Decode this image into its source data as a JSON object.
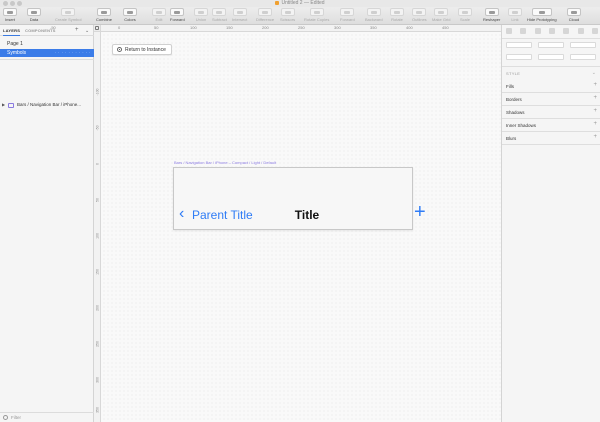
{
  "window": {
    "title": "Untitled 2 — Edited"
  },
  "toolbar": {
    "items": [
      {
        "label": "Insert",
        "enabled": true,
        "icon": "plus-icon"
      },
      {
        "label": "Data",
        "enabled": true,
        "icon": "data-icon"
      },
      {
        "label": "Create Symbol",
        "enabled": false,
        "icon": "symbol-icon"
      },
      {
        "label": "Combine",
        "enabled": true,
        "icon": "combine-icon"
      },
      {
        "label": "Colors",
        "enabled": true,
        "icon": "colors-icon"
      },
      {
        "label": "Edit",
        "enabled": false,
        "icon": "edit-icon"
      },
      {
        "label": "Forward",
        "enabled": true,
        "icon": "forward-icon"
      },
      {
        "label": "Union",
        "enabled": false,
        "icon": "union-icon"
      },
      {
        "label": "Subtract",
        "enabled": false,
        "icon": "subtract-icon"
      },
      {
        "label": "Intersect",
        "enabled": false,
        "icon": "intersect-icon"
      },
      {
        "label": "Difference",
        "enabled": false,
        "icon": "difference-icon"
      },
      {
        "label": "Scissors",
        "enabled": false,
        "icon": "scissors-icon"
      },
      {
        "label": "Rotate Copies",
        "enabled": false,
        "icon": "rotate-copies-icon"
      },
      {
        "label": "Forward",
        "enabled": false,
        "icon": "forward-icon"
      },
      {
        "label": "Backward",
        "enabled": false,
        "icon": "backward-icon"
      },
      {
        "label": "Rotate",
        "enabled": false,
        "icon": "rotate-icon"
      },
      {
        "label": "Outlines",
        "enabled": false,
        "icon": "outlines-icon"
      },
      {
        "label": "Make Grid",
        "enabled": false,
        "icon": "make-grid-icon"
      },
      {
        "label": "Scale",
        "enabled": false,
        "icon": "scale-icon"
      },
      {
        "label": "Reshaper",
        "enabled": true,
        "icon": "reshaper-icon"
      },
      {
        "label": "Link",
        "enabled": false,
        "icon": "link-icon"
      },
      {
        "label": "Hide Prototyping",
        "enabled": true,
        "icon": "prototyping-icon"
      },
      {
        "label": "Cloud",
        "enabled": true,
        "icon": "cloud-icon"
      }
    ]
  },
  "sidebar": {
    "tabs": [
      "LAYERS",
      "COMPONENTS"
    ],
    "pages": [
      "Page 1",
      "Symbols"
    ],
    "layers": [
      {
        "name": "Bars / Navigation Bar / iPhone..."
      }
    ],
    "filter_placeholder": "Filter"
  },
  "canvas": {
    "ruler_top": [
      "-50",
      "0",
      "50",
      "100",
      "150",
      "200",
      "250",
      "300",
      "350",
      "400",
      "450"
    ],
    "ruler_left": [
      "-100",
      "-50",
      "0",
      "50",
      "100",
      "150",
      "200",
      "250",
      "300",
      "350",
      "400"
    ],
    "return_button_label": "Return to Instance",
    "artboard_label": "Bars / Navigation Bar / iPhone – Compact / Light / Default",
    "navbar": {
      "back_chevron": "‹",
      "back_label": "Parent Title",
      "title": "Title",
      "action_icon": "plus-icon"
    },
    "accent_color": "#2f7cf6"
  },
  "inspector": {
    "style_header": "STYLE",
    "sections": [
      "Fills",
      "Borders",
      "Shadows",
      "Inner Shadows",
      "Blurs"
    ]
  }
}
